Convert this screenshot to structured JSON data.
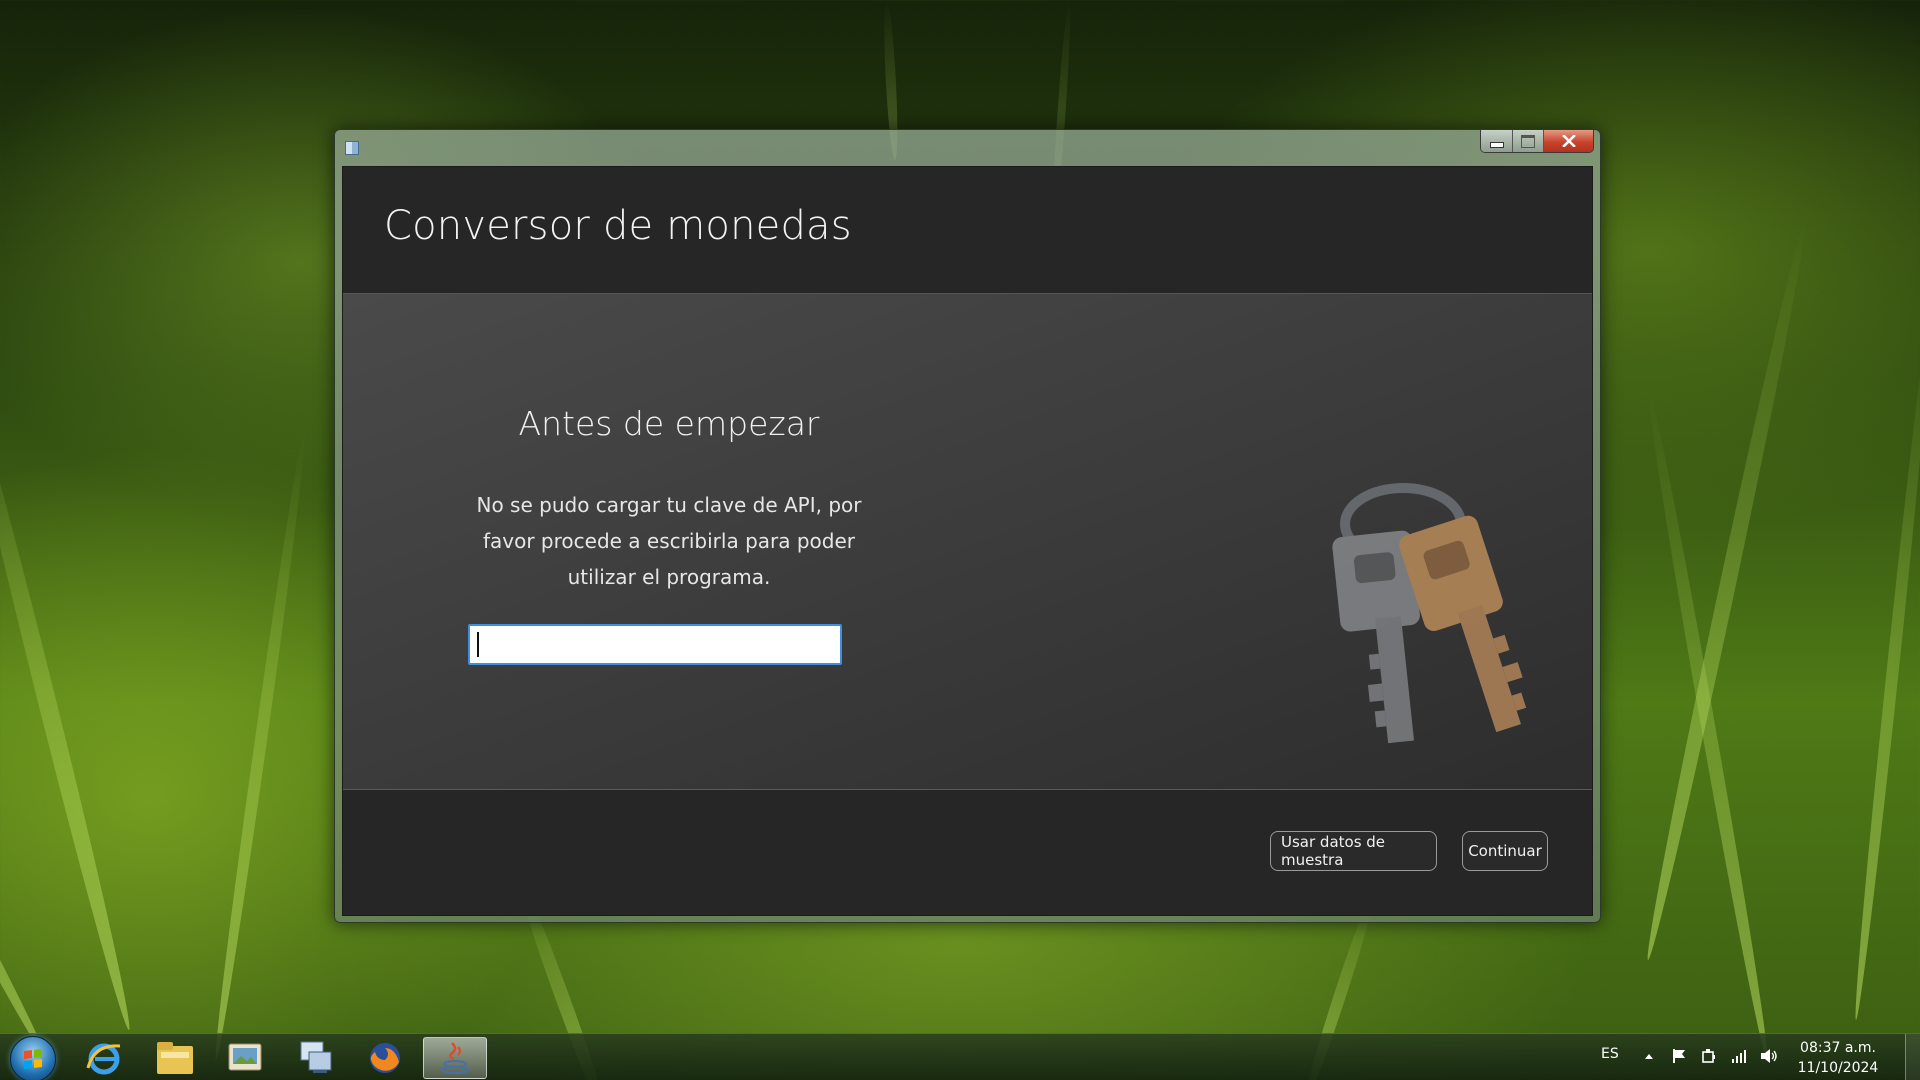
{
  "window": {
    "title": "Conversor de monedas",
    "caption": {
      "minimize": "Minimize",
      "maximize": "Maximize",
      "close": "Close"
    }
  },
  "content": {
    "section_title": "Antes de empezar",
    "message": "No se pudo cargar tu clave de API, por favor procede a escribirla para poder utilizar el programa.",
    "api_key_input": {
      "value": "",
      "placeholder": ""
    }
  },
  "footer": {
    "sample_button": "Usar datos de muestra",
    "continue_button": "Continuar"
  },
  "taskbar": {
    "pinned": [
      "internet-explorer-icon",
      "file-explorer-icon",
      "photos-icon",
      "network-desktop-icon",
      "firefox-icon",
      "java-icon"
    ],
    "active_app": "java-icon",
    "language": "ES",
    "clock_time": "08:37 a.m.",
    "clock_date": "11/10/2024"
  },
  "colors": {
    "accent": "#3d8fe0",
    "window_bg": "#262626",
    "content_bg": "#404040",
    "close_button": "#c8432b"
  }
}
